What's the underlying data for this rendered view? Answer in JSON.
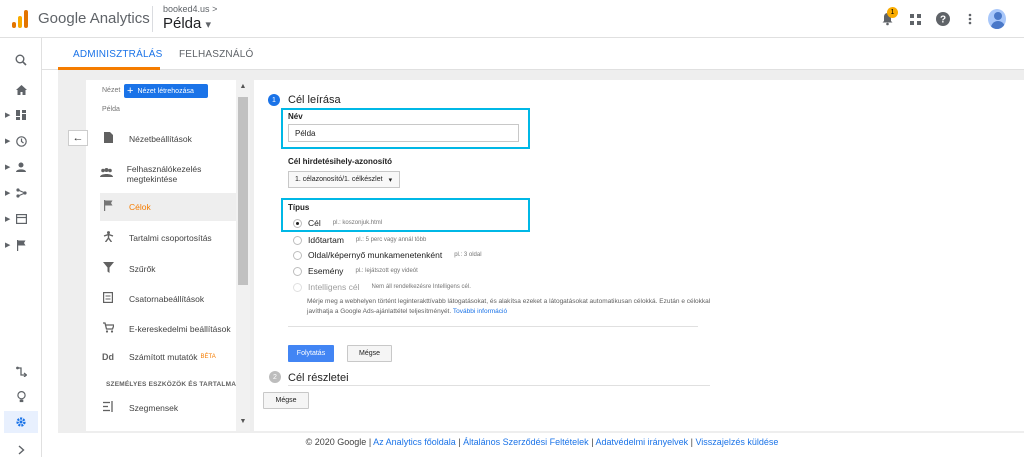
{
  "header": {
    "brand": "Google Analytics",
    "account": "booked4.us",
    "account_chevron": ">",
    "property": "Példa",
    "property_caret": "▾",
    "notification_count": "1"
  },
  "tabs": [
    {
      "label": "ADMINISZTRÁLÁS",
      "active": true
    },
    {
      "label": "FELHASZNÁLÓ",
      "active": false
    }
  ],
  "sidebar_nav": {
    "items": [
      "search-icon",
      "home-icon",
      "dashboard-icon",
      "clock-icon",
      "person-icon",
      "acquisition-icon",
      "behavior-icon",
      "flag-icon"
    ],
    "bottom": [
      "attribution-icon",
      "lightbulb-icon",
      "settings-icon",
      "expand-icon"
    ]
  },
  "view_panel": {
    "view_label": "Nézet",
    "create_button": "Nézet létrehozása",
    "view_name": "Példa",
    "back_arrow": "←",
    "items": [
      {
        "label": "Nézetbeállítások",
        "icon": "document-icon"
      },
      {
        "label": "Felhasználókezelés megtekintése",
        "icon": "people-icon"
      },
      {
        "label": "Célok",
        "icon": "flag-icon",
        "active": true
      },
      {
        "label": "Tartalmi csoportosítás",
        "icon": "content-grouping-icon"
      },
      {
        "label": "Szűrők",
        "icon": "filter-icon"
      },
      {
        "label": "Csatornabeállítások",
        "icon": "channel-icon"
      },
      {
        "label": "E-kereskedelmi beállítások",
        "icon": "cart-icon"
      },
      {
        "label": "Számított mutatók",
        "icon": "calculated-icon",
        "badge": "BÉTA"
      }
    ],
    "section_heading": "SZEMÉLYES ESZKÖZÖK ÉS TARTALMAK",
    "section_items": [
      {
        "label": "Szegmensek",
        "icon": "segments-icon"
      }
    ]
  },
  "goal_form": {
    "step1_number": "1",
    "step1_title": "Cél leírása",
    "name_label": "Név",
    "name_value": "Példa",
    "slot_label": "Cél hirdetésihely-azonosító",
    "slot_value": "1. célazonosító/1. célkészlet",
    "type_label": "Típus",
    "types": [
      {
        "label": "Cél",
        "example": "pl.: koszonjuk.html",
        "checked": true
      },
      {
        "label": "Időtartam",
        "example": "pl.: 5 perc vagy annál több"
      },
      {
        "label": "Oldal/képernyő munkamenetenként",
        "example": "pl.: 3 oldal"
      },
      {
        "label": "Esemény",
        "example": "pl.: lejátszott egy videót"
      },
      {
        "label": "Intelligens cél",
        "example": "Nem áll rendelkezésre Intelligens cél.",
        "disabled": true
      }
    ],
    "smart_desc": "Mérje meg a webhelyen történt leginterakttívabb látogatásokat, és alakítsa ezeket a látogatásokat automatikusan célokká. Ezután e célokkal javíthatja a Google Ads-ajánlattétel teljesítményét.",
    "smart_link": "További információ",
    "continue_button": "Folytatás",
    "cancel_button": "Mégse",
    "step2_number": "2",
    "step2_title": "Cél részletei",
    "cancel_button_bottom": "Mégse"
  },
  "footer": {
    "copyright": "© 2020 Google |",
    "links": [
      "Az Analytics főoldala",
      "Általános Szerződési Feltételek",
      "Adatvédelmi irányelvek",
      "Visszajelzés küldése"
    ],
    "separator": "|"
  },
  "colors": {
    "accent": "#1a73e8",
    "orange": "#f57c00",
    "highlight": "#00b8e6"
  }
}
